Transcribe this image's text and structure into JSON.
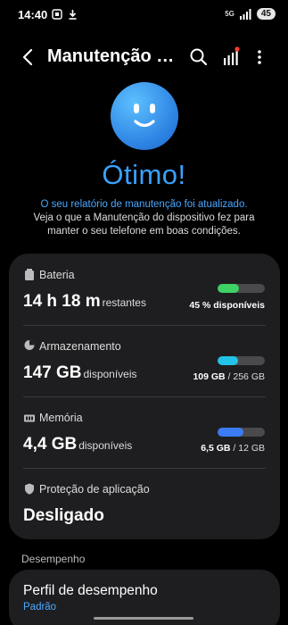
{
  "status_bar": {
    "time": "14:40",
    "network_label": "5G",
    "battery_level": "45"
  },
  "app_bar": {
    "title": "Manutenção do dispositivo",
    "back_icon": "back-arrow-icon",
    "search_icon": "search-icon",
    "chart_icon": "chart-icon",
    "menu_icon": "more-vert-icon"
  },
  "hero": {
    "title": "Ótimo!",
    "report_line": "O seu relatório de manutenção foi atualizado.",
    "description": "Veja o que a Manutenção do dispositivo fez para manter o seu telefone em boas condições."
  },
  "metrics": {
    "battery": {
      "label": "Bateria",
      "value": "14 h 18 m",
      "unit": "restantes",
      "percent": 0.45,
      "caption": "45 % disponíveis",
      "color": "#3ed163"
    },
    "storage": {
      "label": "Armazenamento",
      "value": "147 GB",
      "unit": "disponíveis",
      "used": "109 GB",
      "total": "/ 256 GB",
      "fraction": 0.43,
      "color": "#22c3e6"
    },
    "memory": {
      "label": "Memória",
      "value": "4,4 GB",
      "unit": "disponíveis",
      "used": "6,5 GB",
      "total": "/ 12 GB",
      "fraction": 0.54,
      "color": "#3b7cf5"
    },
    "app_protection": {
      "label": "Proteção de aplicação",
      "value": "Desligado"
    }
  },
  "performance": {
    "section_label": "Desempenho",
    "profile_title": "Perfil de desempenho",
    "profile_value": "Padrão"
  }
}
